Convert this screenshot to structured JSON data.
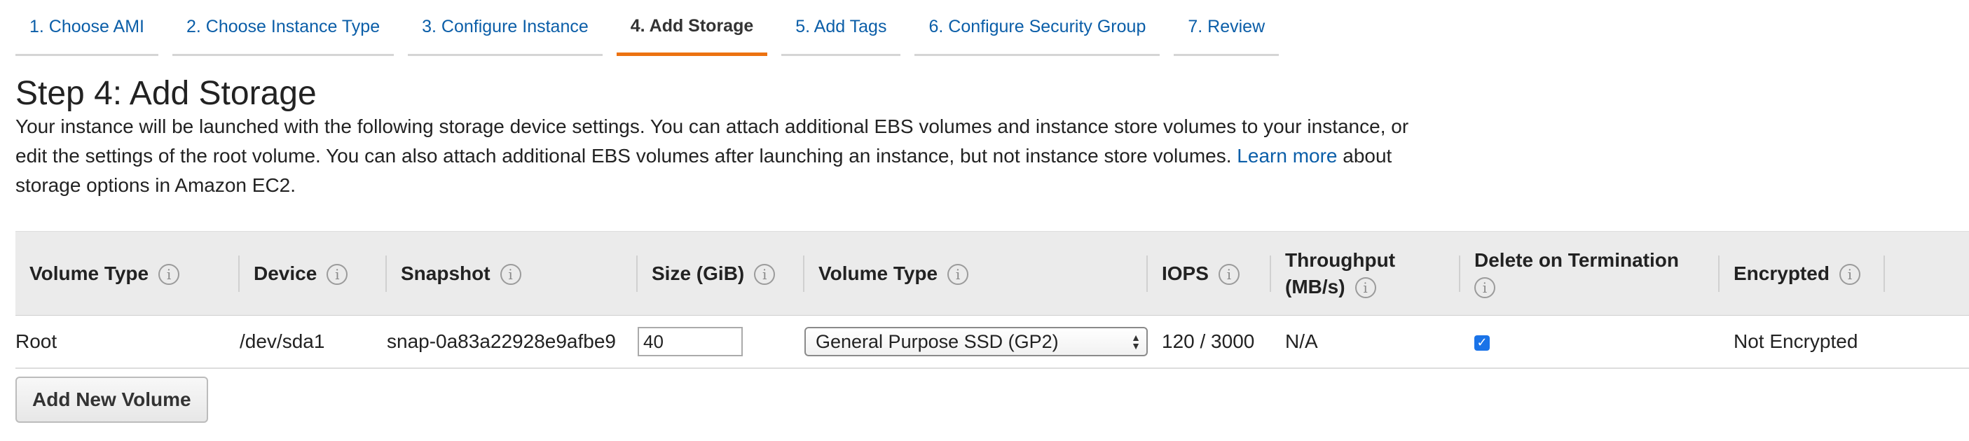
{
  "tabs": [
    {
      "label": "1. Choose AMI"
    },
    {
      "label": "2. Choose Instance Type"
    },
    {
      "label": "3. Configure Instance"
    },
    {
      "label": "4. Add Storage",
      "active": true
    },
    {
      "label": "5. Add Tags"
    },
    {
      "label": "6. Configure Security Group"
    },
    {
      "label": "7. Review"
    }
  ],
  "page": {
    "title": "Step 4: Add Storage",
    "description_before": "Your instance will be launched with the following storage device settings. You can attach additional EBS volumes and instance store volumes to your instance, or edit the settings of the root volume. You can also attach additional EBS volumes after launching an instance, but not instance store volumes. ",
    "learn_more": "Learn more",
    "description_after": " about storage options in Amazon EC2."
  },
  "table": {
    "headers": {
      "volume_type": "Volume Type",
      "device": "Device",
      "snapshot": "Snapshot",
      "size": "Size (GiB)",
      "ebs_volume_type": "Volume Type",
      "iops": "IOPS",
      "throughput": "Throughput (MB/s)",
      "delete_on_termination": "Delete on Termination",
      "encrypted": "Encrypted"
    },
    "row": {
      "volume_type": "Root",
      "device": "/dev/sda1",
      "snapshot": "snap-0a83a22928e9afbe9",
      "size": "40",
      "ebs_volume_type": "General Purpose SSD (GP2)",
      "iops": "120 / 3000",
      "throughput": "N/A",
      "delete_on_termination": true,
      "encrypted": "Not Encrypted"
    }
  },
  "buttons": {
    "add_new_volume": "Add New Volume"
  },
  "icons": {
    "info": "i",
    "check": "✓",
    "select_up": "▲",
    "select_down": "▼"
  },
  "colors": {
    "active_tab_accent": "#ec7211",
    "link": "#0b5ea8",
    "checkbox": "#1a73e8"
  }
}
